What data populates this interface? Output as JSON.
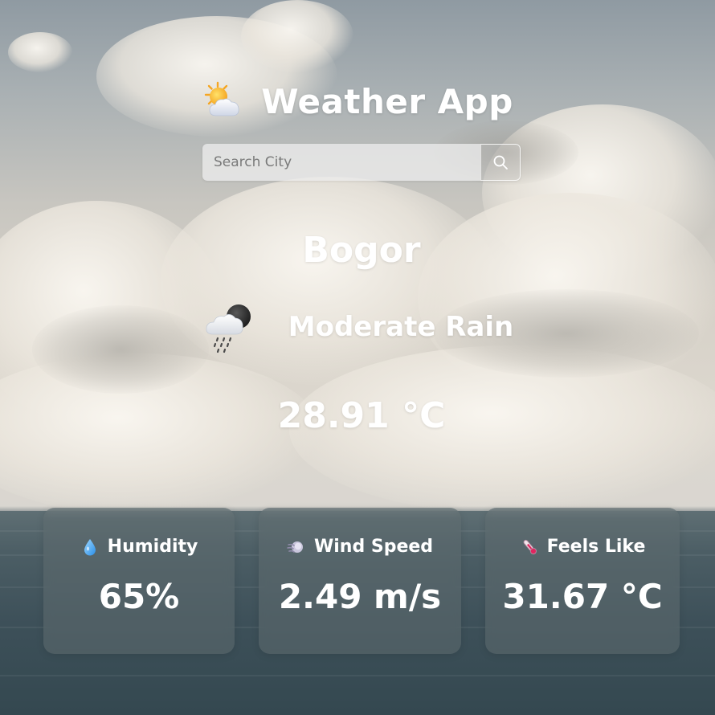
{
  "header": {
    "title": "Weather App",
    "logo_icon": "sun-behind-cloud-icon"
  },
  "search": {
    "placeholder": "Search City",
    "value": "",
    "button_icon": "search-icon"
  },
  "weather": {
    "city": "Bogor",
    "condition": "Moderate Rain",
    "condition_icon": "cloud-rain-moon-icon",
    "temperature": "28.91 °C"
  },
  "stats": [
    {
      "icon": "droplet-icon",
      "label": "Humidity",
      "value": "65%"
    },
    {
      "icon": "wind-icon",
      "label": "Wind Speed",
      "value": "2.49 m/s"
    },
    {
      "icon": "thermometer-icon",
      "label": "Feels Like",
      "value": "31.67 °C"
    }
  ],
  "colors": {
    "text": "#ffffff",
    "card_bg": "rgba(95,108,112,0.55)",
    "sky": "#c8c6c0",
    "sea": "#3d5059"
  }
}
